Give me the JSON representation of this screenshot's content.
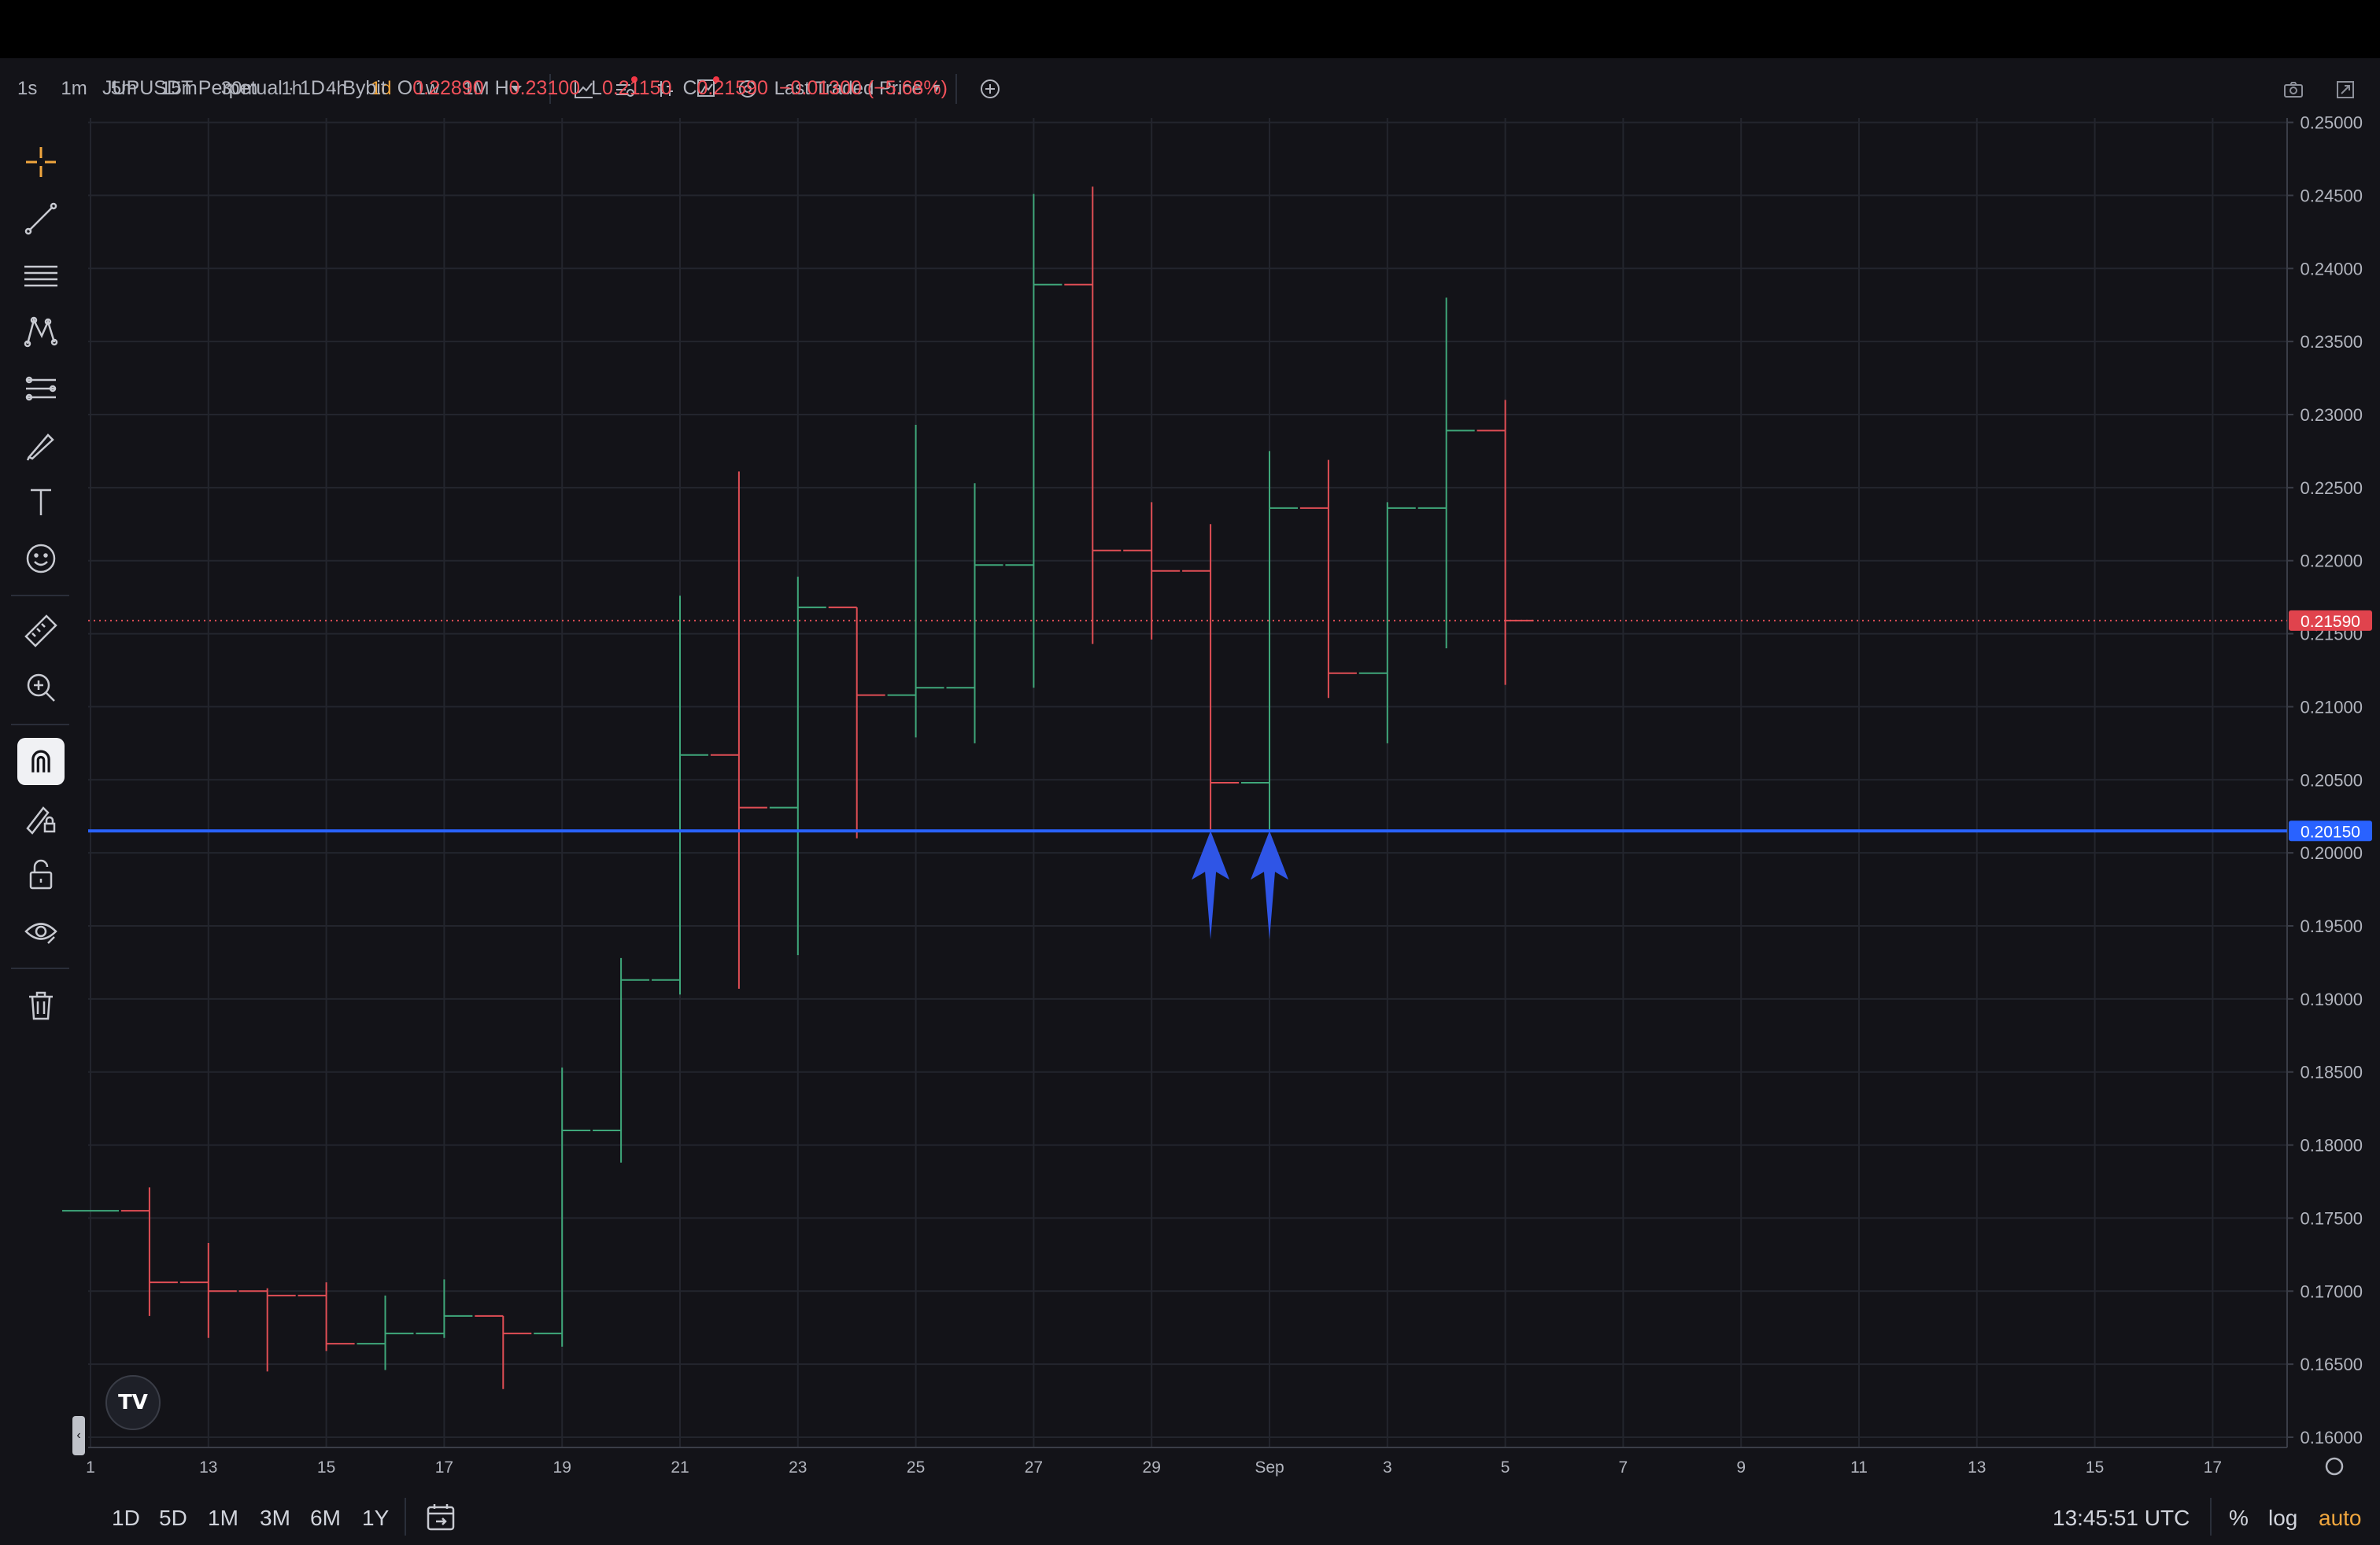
{
  "toolbar": {
    "timeframes": [
      "1s",
      "1m",
      "5m",
      "15m",
      "30m",
      "1h",
      "4h",
      "1d",
      "1w",
      "1M"
    ],
    "active_timeframe": "1d",
    "price_type": "Last Traded Price"
  },
  "legend": {
    "title": "JUPUSDT Perpetual · 1D · Bybit",
    "open_label": "O",
    "open": "0.22890",
    "high_label": "H",
    "high": "0.23100",
    "low_label": "L",
    "low": "0.21150",
    "close_label": "C",
    "close": "0.21590",
    "change": "−0.01300 (−5.68%)"
  },
  "bottom": {
    "ranges": [
      "1D",
      "5D",
      "1M",
      "3M",
      "6M",
      "1Y"
    ],
    "clock": "13:45:51 UTC",
    "percent": "%",
    "log": "log",
    "auto": "auto"
  },
  "colors": {
    "up": "#3fa77a",
    "down": "#e04e55",
    "support_line": "#2962ff",
    "arrow": "#2f55e6",
    "background": "#131318",
    "grid": "#23252d"
  },
  "chart_data": {
    "type": "ohlc",
    "x_tick_labels": [
      "1",
      "13",
      "15",
      "17",
      "19",
      "21",
      "23",
      "25",
      "27",
      "29",
      "Sep",
      "3",
      "5",
      "7",
      "9",
      "11",
      "13",
      "15",
      "17"
    ],
    "y_tick_labels": [
      "0.16000",
      "0.16500",
      "0.17000",
      "0.17500",
      "0.18000",
      "0.18500",
      "0.19000",
      "0.19500",
      "0.20000",
      "0.20500",
      "0.21000",
      "0.21500",
      "0.22000",
      "0.22500",
      "0.23000",
      "0.23500",
      "0.24000",
      "0.24500",
      "0.25000"
    ],
    "ylim": [
      0.1593,
      0.2503
    ],
    "grid": true,
    "bars": [
      {
        "date": "Aug 11",
        "o": 0.1755,
        "h": 0.1755,
        "l": 0.1755,
        "c": 0.1755
      },
      {
        "date": "Aug 12",
        "o": 0.1755,
        "h": 0.1771,
        "l": 0.1683,
        "c": 0.1706
      },
      {
        "date": "Aug 13",
        "o": 0.1706,
        "h": 0.1733,
        "l": 0.1668,
        "c": 0.17
      },
      {
        "date": "Aug 14",
        "o": 0.17,
        "h": 0.1702,
        "l": 0.1645,
        "c": 0.1697
      },
      {
        "date": "Aug 15",
        "o": 0.1697,
        "h": 0.1706,
        "l": 0.1659,
        "c": 0.1664
      },
      {
        "date": "Aug 16",
        "o": 0.1664,
        "h": 0.1697,
        "l": 0.1646,
        "c": 0.1671
      },
      {
        "date": "Aug 17",
        "o": 0.1671,
        "h": 0.1708,
        "l": 0.1668,
        "c": 0.1683
      },
      {
        "date": "Aug 18",
        "o": 0.1683,
        "h": 0.1683,
        "l": 0.1633,
        "c": 0.1671
      },
      {
        "date": "Aug 19",
        "o": 0.1671,
        "h": 0.1853,
        "l": 0.1662,
        "c": 0.181
      },
      {
        "date": "Aug 20",
        "o": 0.181,
        "h": 0.1928,
        "l": 0.1788,
        "c": 0.1913
      },
      {
        "date": "Aug 21",
        "o": 0.1913,
        "h": 0.2176,
        "l": 0.1903,
        "c": 0.2067
      },
      {
        "date": "Aug 22",
        "o": 0.2067,
        "h": 0.2261,
        "l": 0.1907,
        "c": 0.2031
      },
      {
        "date": "Aug 23",
        "o": 0.2031,
        "h": 0.2189,
        "l": 0.193,
        "c": 0.2168
      },
      {
        "date": "Aug 24",
        "o": 0.2168,
        "h": 0.2168,
        "l": 0.201,
        "c": 0.2108
      },
      {
        "date": "Aug 25",
        "o": 0.2108,
        "h": 0.2293,
        "l": 0.2079,
        "c": 0.2113
      },
      {
        "date": "Aug 26",
        "o": 0.2113,
        "h": 0.2253,
        "l": 0.2075,
        "c": 0.2197
      },
      {
        "date": "Aug 27",
        "o": 0.2197,
        "h": 0.2451,
        "l": 0.2113,
        "c": 0.2389
      },
      {
        "date": "Aug 28",
        "o": 0.2389,
        "h": 0.2456,
        "l": 0.2143,
        "c": 0.2207
      },
      {
        "date": "Aug 29",
        "o": 0.2207,
        "h": 0.224,
        "l": 0.2146,
        "c": 0.2193
      },
      {
        "date": "Aug 30",
        "o": 0.2193,
        "h": 0.2225,
        "l": 0.2016,
        "c": 0.2048
      },
      {
        "date": "Aug 31",
        "o": 0.2048,
        "h": 0.2275,
        "l": 0.2016,
        "c": 0.2236
      },
      {
        "date": "Sep 1",
        "o": 0.2236,
        "h": 0.2269,
        "l": 0.2106,
        "c": 0.2123
      },
      {
        "date": "Sep 2",
        "o": 0.2123,
        "h": 0.224,
        "l": 0.2075,
        "c": 0.2236
      },
      {
        "date": "Sep 3",
        "o": 0.2236,
        "h": 0.238,
        "l": 0.214,
        "c": 0.2289
      },
      {
        "date": "Sep 4",
        "o": 0.2289,
        "h": 0.231,
        "l": 0.2115,
        "c": 0.2159
      }
    ],
    "last_price": "0.21590",
    "horizontal_line": {
      "value": "0.20150"
    },
    "arrows": [
      {
        "date": "Aug 30",
        "points_to": "0.20150"
      },
      {
        "date": "Aug 31",
        "points_to": "0.20150"
      }
    ]
  }
}
